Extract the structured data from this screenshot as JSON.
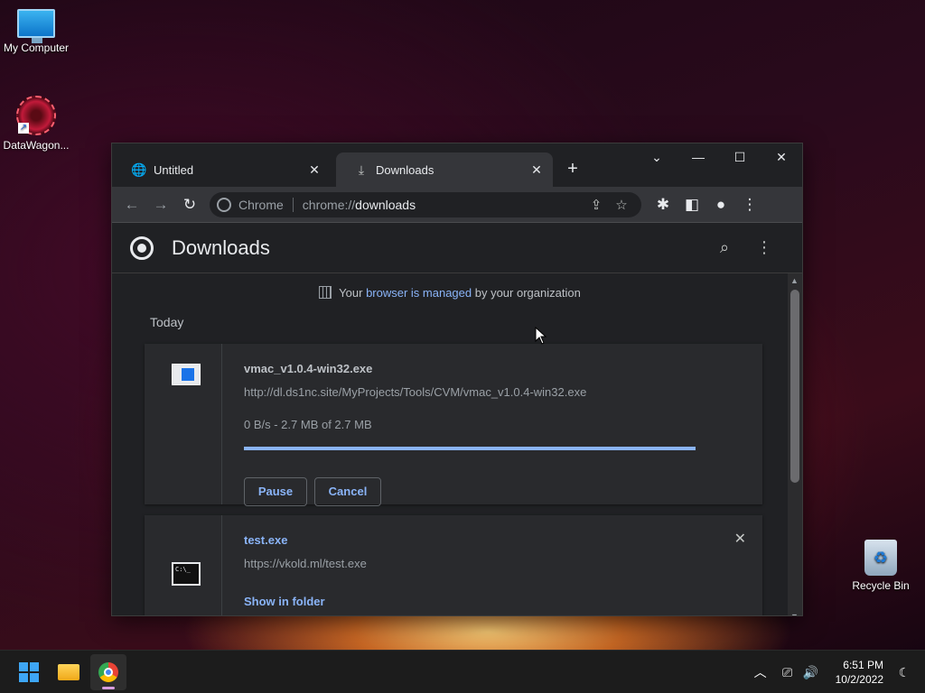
{
  "desktop": {
    "icons": [
      {
        "label": "My Computer",
        "icon": "monitor-icon"
      },
      {
        "label": "DataWagon...",
        "icon": "datawagon-icon"
      },
      {
        "label": "Recycle Bin",
        "icon": "recycle-bin-icon"
      }
    ]
  },
  "browser": {
    "tabs": [
      {
        "title": "Untitled",
        "icon": "globe-icon",
        "active": false
      },
      {
        "title": "Downloads",
        "icon": "download-icon",
        "active": true
      }
    ],
    "new_tab": "+",
    "window_controls": {
      "tab_search": "⌄",
      "minimize": "—",
      "maximize": "☐",
      "close": "✕"
    },
    "omnibox": {
      "chip": "Chrome",
      "scheme": "chrome://",
      "path": "downloads"
    }
  },
  "downloads": {
    "title": "Downloads",
    "managed": {
      "prefix": "Your ",
      "link": "browser is managed",
      "suffix": " by your organization"
    },
    "section": "Today",
    "items": [
      {
        "name": "vmac_v1.0.4-win32.exe",
        "url": "http://dl.ds1nc.site/MyProjects/Tools/CVM/vmac_v1.0.4-win32.exe",
        "status": "0 B/s - 2.7 MB of 2.7 MB",
        "progress": 1.0,
        "pause_label": "Pause",
        "cancel_label": "Cancel"
      },
      {
        "name": "test.exe",
        "url": "https://vkold.ml/test.exe",
        "folder_link": "Show in folder",
        "icon_text": "C:\\_"
      }
    ]
  },
  "taskbar": {
    "time": "6:51 PM",
    "date": "10/2/2022"
  },
  "colors": {
    "link": "#8ab4f8",
    "page_bg": "#202124",
    "toolbar_bg": "#35363a"
  }
}
